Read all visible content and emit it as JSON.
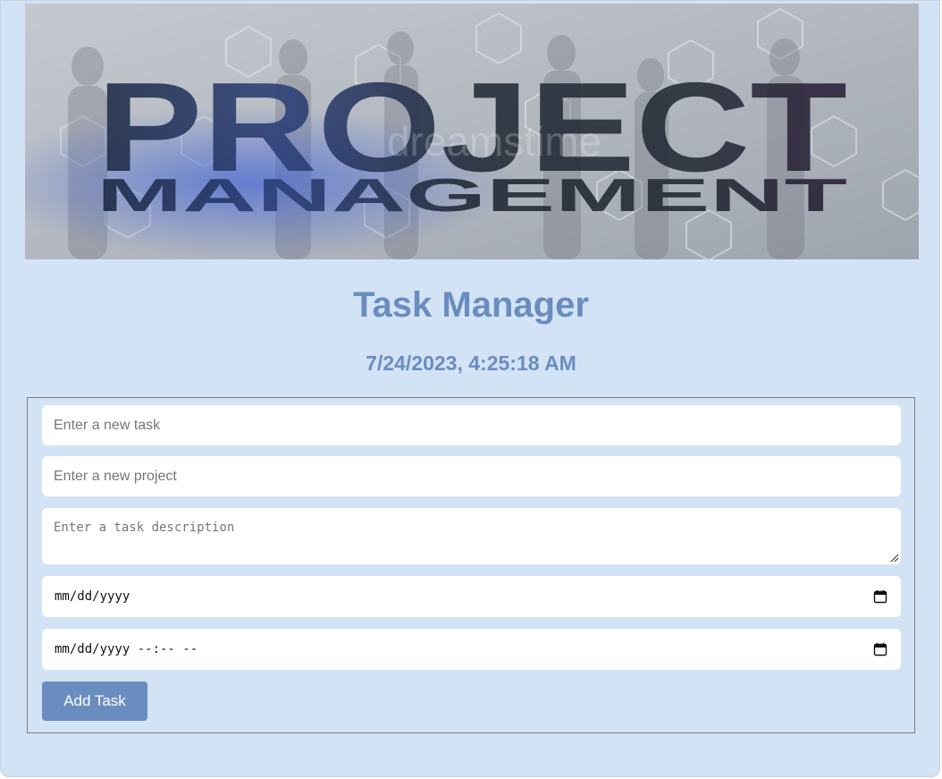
{
  "banner": {
    "title_line1": "PROJECT",
    "title_line2": "MANAGEMENT",
    "watermark": "dreamstime"
  },
  "header": {
    "title": "Task Manager",
    "datetime": "7/24/2023, 4:25:18 AM"
  },
  "form": {
    "task_placeholder": "Enter a new task",
    "project_placeholder": "Enter a new project",
    "description_placeholder": "Enter a task description",
    "date_placeholder": "mm/dd/yyyy",
    "datetime_placeholder": "mm/dd/yyyy --:-- --",
    "add_button_label": "Add Task"
  },
  "colors": {
    "page_background": "#d3e3f6",
    "accent": "#6a8dbf",
    "field_background": "#ffffff"
  },
  "icons": {
    "date_picker": "calendar-icon",
    "datetime_picker": "calendar-icon",
    "textarea_resize": "resize-grip-icon"
  }
}
